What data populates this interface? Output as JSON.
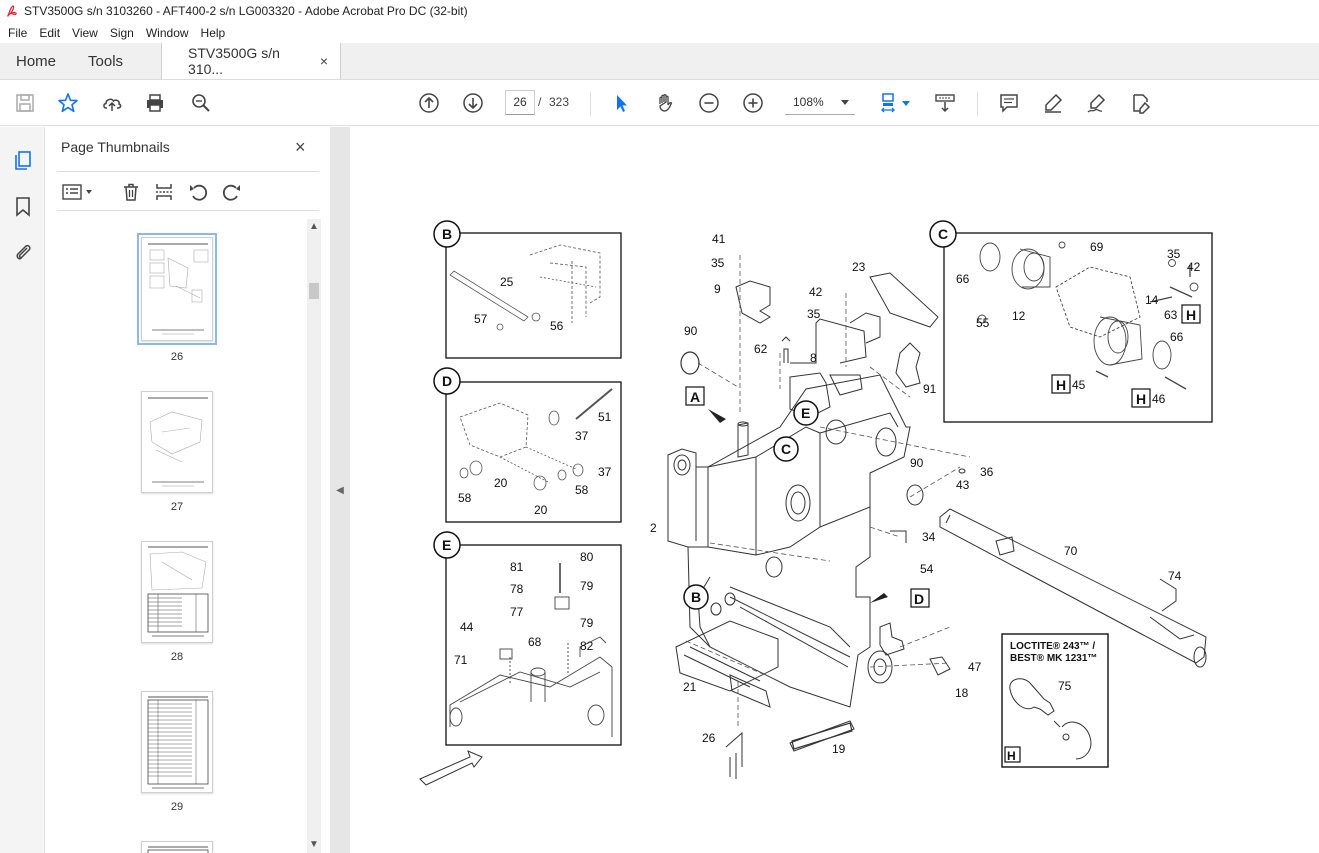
{
  "window": {
    "title": "STV3500G s/n 3103260 - AFT400-2 s/n LG003320 - Adobe Acrobat Pro DC (32-bit)"
  },
  "menu": [
    "File",
    "Edit",
    "View",
    "Sign",
    "Window",
    "Help"
  ],
  "tabs": {
    "home": "Home",
    "tools": "Tools",
    "document": "STV3500G s/n 310...",
    "close": "×"
  },
  "toolbar": {
    "current_page": "26",
    "separator": "/",
    "total_pages": "323",
    "zoom": "108%"
  },
  "panel": {
    "title": "Page Thumbnails",
    "close": "×",
    "thumbnails": [
      {
        "page": "26",
        "selected": true
      },
      {
        "page": "27",
        "selected": false
      },
      {
        "page": "28",
        "selected": false
      },
      {
        "page": "29",
        "selected": false
      }
    ]
  },
  "diagram": {
    "inset_callouts": [
      "B",
      "D",
      "E",
      "C",
      "H"
    ],
    "inset_b_labels": [
      "25",
      "57",
      "56"
    ],
    "inset_d_labels": [
      "51",
      "37",
      "37",
      "20",
      "58",
      "58",
      "20"
    ],
    "inset_e_labels": [
      "81",
      "80",
      "79",
      "78",
      "77",
      "79",
      "44",
      "68",
      "82",
      "71"
    ],
    "inset_c_labels": [
      "69",
      "35",
      "42",
      "66",
      "14",
      "63",
      "12",
      "55",
      "66",
      "45",
      "46"
    ],
    "main_labels": [
      "41",
      "35",
      "9",
      "23",
      "42",
      "35",
      "90",
      "62",
      "8",
      "91",
      "A",
      "E",
      "C",
      "90",
      "36",
      "43",
      "2",
      "34",
      "70",
      "54",
      "74",
      "B",
      "D",
      "47",
      "21",
      "18",
      "26",
      "19"
    ],
    "loctite_line1": "LOCTITE® 243™ /",
    "loctite_line2": "BEST® MK 1231™",
    "loctite_number": "75",
    "loctite_tag": "H"
  }
}
